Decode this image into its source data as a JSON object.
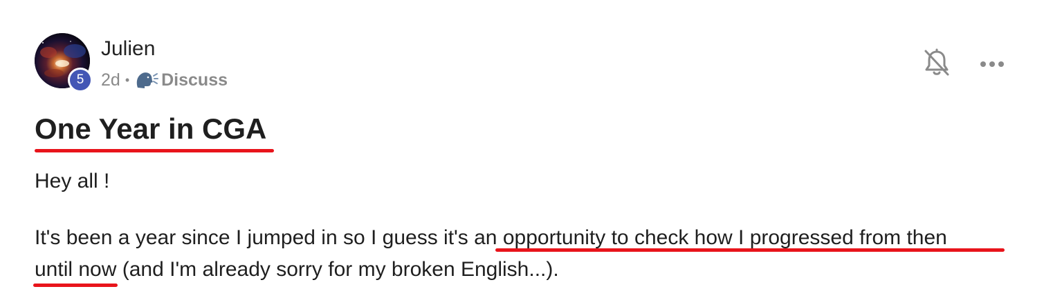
{
  "author": {
    "name": "Julien",
    "level": "5",
    "avatar_icon": "galaxy-avatar"
  },
  "meta": {
    "time_ago": "2d",
    "separator": "•",
    "category_icon": "speaking-head-icon",
    "category": "Discuss"
  },
  "actions": {
    "notifications_icon": "bell-off-icon",
    "more_icon": "more-horizontal-icon"
  },
  "post": {
    "title": "One Year in CGA",
    "greeting": "Hey all !",
    "body_line1_before": "It's been a year since I jumped in so I guess it's ",
    "body_line1_highlight": "an opportunity to check how I progressed from then",
    "body_line2_highlight": "until now",
    "body_line2_after": " (and I'm already sorry for my broken English...)."
  },
  "colors": {
    "underline_marker": "#e8141b",
    "level_badge": "#4356b5",
    "meta_text": "#8a8a8a",
    "icon": "#8a8a8a"
  }
}
